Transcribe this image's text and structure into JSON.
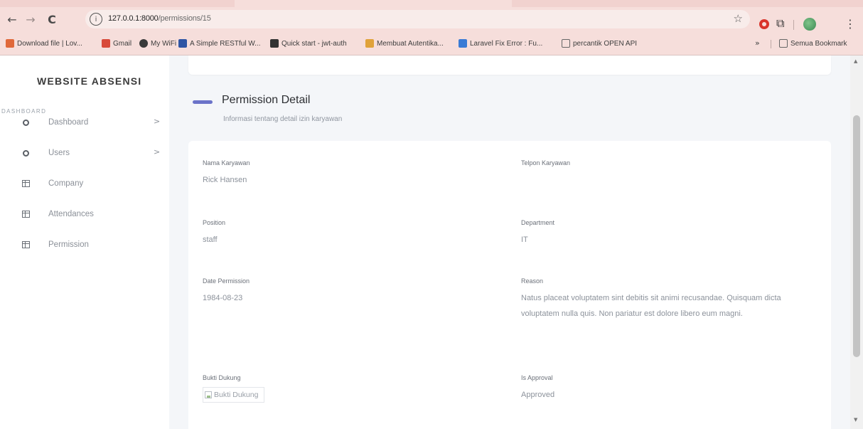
{
  "browser": {
    "nav": {
      "back": "←",
      "forward": "→",
      "reload": "C"
    },
    "url": {
      "host": "127.0.0.1:8000",
      "path": "/permissions/15"
    },
    "icons": {
      "info": "ⓘ",
      "star": "☆",
      "puzzle": "⧉",
      "kebab": "⋮"
    },
    "bookmarks": [
      {
        "label": "Download file | Lov...",
        "color": "#e0683a"
      },
      {
        "label": "Gmail",
        "color": "#d84a3a"
      },
      {
        "label": "My WiFi",
        "color": "#3a3a3a"
      },
      {
        "label": "A Simple RESTful W...",
        "color": "#2f55a4"
      },
      {
        "label": "Quick start - jwt-auth",
        "color": "#333333"
      },
      {
        "label": "Membuat Autentika...",
        "color": "#e0a23a"
      },
      {
        "label": "Laravel Fix Error : Fu...",
        "color": "#3a7bd5"
      },
      {
        "label": "percantik OPEN API",
        "color": "#666666"
      }
    ],
    "bookmarks_more": "»",
    "all_bookmarks": "Semua Bookmark"
  },
  "sidebar": {
    "brand": "WEBSITE ABSENSI",
    "section_label": "DASHBOARD",
    "items": [
      {
        "label": "Dashboard",
        "icon": "circle-icon",
        "chevron": ">"
      },
      {
        "label": "Users",
        "icon": "circle-icon",
        "chevron": ">"
      },
      {
        "label": "Company",
        "icon": "table-icon"
      },
      {
        "label": "Attendances",
        "icon": "table-icon"
      },
      {
        "label": "Permission",
        "icon": "table-icon"
      }
    ]
  },
  "page": {
    "title": "Permission Detail",
    "subtitle": "Informasi tentang detail izin karyawan",
    "accent": "#6b73c9"
  },
  "detail": {
    "employee_name": {
      "label": "Nama Karyawan",
      "value": "Rick Hansen"
    },
    "employee_phone": {
      "label": "Telpon Karyawan",
      "value": ""
    },
    "position": {
      "label": "Position",
      "value": "staff"
    },
    "department": {
      "label": "Department",
      "value": "IT"
    },
    "date_permission": {
      "label": "Date Permission",
      "value": "1984-08-23"
    },
    "reason": {
      "label": "Reason",
      "value": "Natus placeat voluptatem sint debitis sit animi recusandae. Quisquam dicta voluptatem nulla quis. Non pariatur est dolore libero eum magni."
    },
    "proof": {
      "label": "Bukti Dukung",
      "alt": "Bukti Dukung"
    },
    "approval": {
      "label": "Is Approval",
      "value": "Approved"
    }
  }
}
